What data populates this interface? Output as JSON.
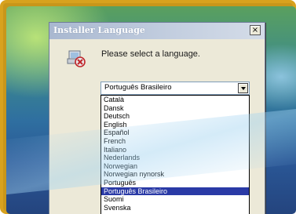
{
  "window": {
    "title": "Installer Language",
    "close_glyph": "×"
  },
  "prompt": "Please select a language.",
  "selected_language": "Português Brasileiro",
  "languages": [
    "Català",
    "Dansk",
    "Deutsch",
    "English",
    "Español",
    "French",
    "Italiano",
    "Nederlands",
    "Norwegian",
    "Norwegian nynorsk",
    "Português",
    "Português Brasileiro",
    "Suomi",
    "Svenska"
  ],
  "highlighted_index": 11,
  "icons": {
    "installer": "installer-error-icon",
    "dropdown": "chevron-down-icon",
    "close": "close-icon"
  },
  "colors": {
    "frame": "#d8a21e",
    "selection": "#2a3aa6",
    "dialog_bg": "#ece9d8"
  }
}
